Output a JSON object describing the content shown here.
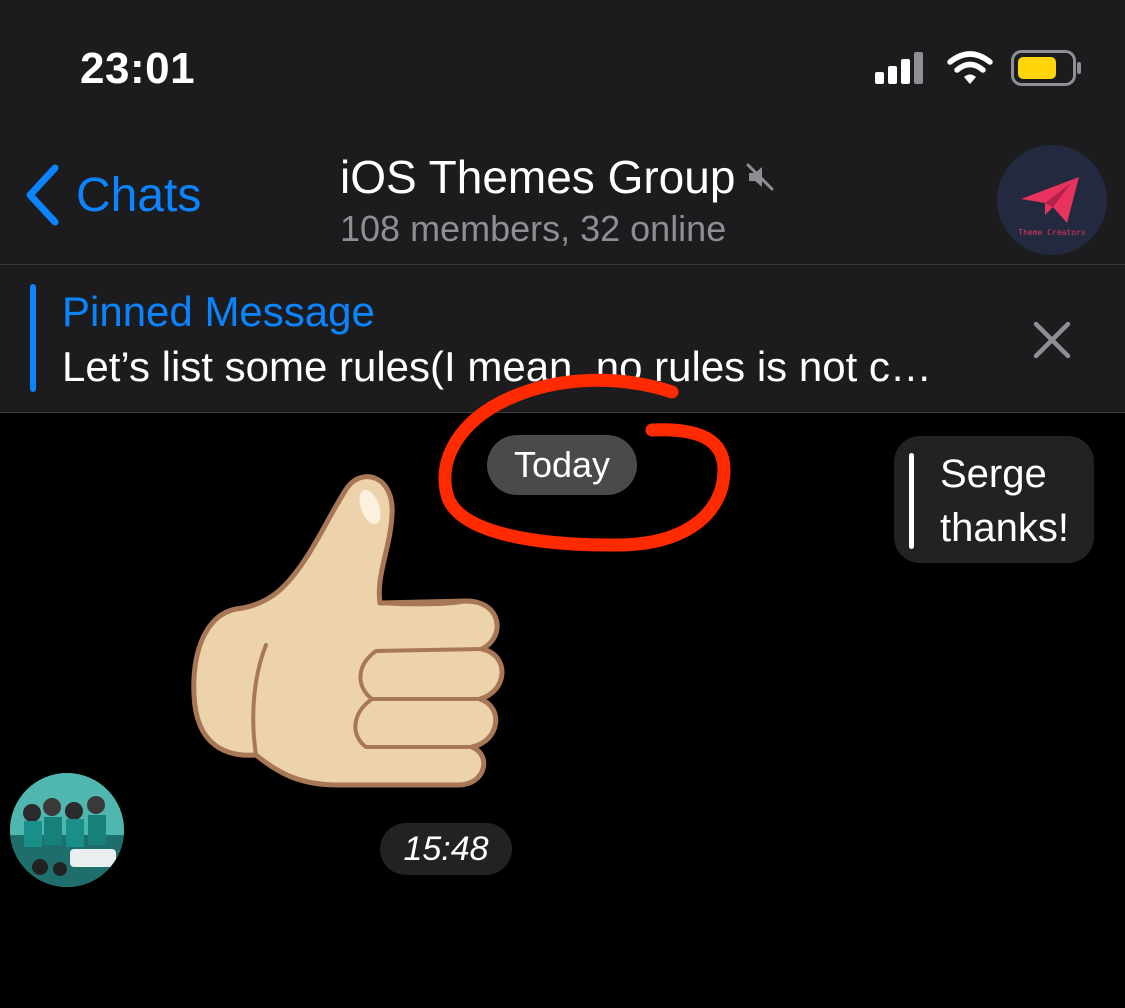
{
  "status_bar": {
    "time": "23:01",
    "icons": [
      "cellular-signal-icon",
      "wifi-icon",
      "battery-icon"
    ],
    "battery_color": "#ffd60a"
  },
  "nav": {
    "back_label": "Chats",
    "title": "iOS Themes Group",
    "muted_icon": "speaker-muted-icon",
    "subtitle": "108 members, 32 online",
    "avatar_caption": "Theme Creators"
  },
  "pinned": {
    "title": "Pinned Message",
    "text": "Let’s list some rules(I mean, no rules is not c…"
  },
  "chat": {
    "date_label": "Today",
    "reply": {
      "name": "Serge",
      "text": "thanks!"
    },
    "sticker": "thumbs-up-sticker",
    "message_time": "15:48"
  },
  "colors": {
    "accent": "#0a84ff",
    "background": "#000000",
    "header": "#1c1c1e",
    "annotation": "#ff2a00"
  }
}
